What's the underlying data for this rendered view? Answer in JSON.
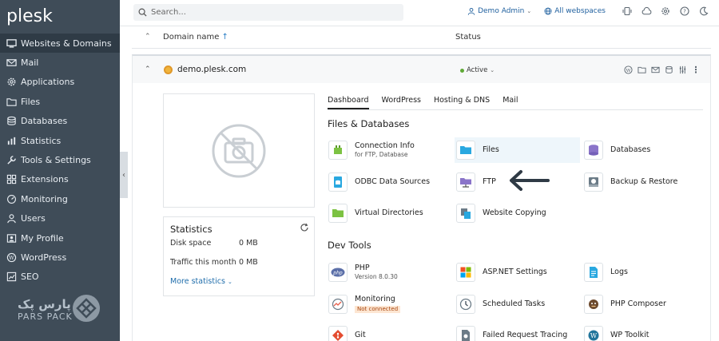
{
  "app": {
    "logo": "plesk"
  },
  "sidebar": {
    "items": [
      {
        "label": "Websites & Domains",
        "icon": "monitor-icon",
        "active": true
      },
      {
        "label": "Mail",
        "icon": "mail-icon"
      },
      {
        "label": "Applications",
        "icon": "gear-icon"
      },
      {
        "label": "Files",
        "icon": "folder-icon"
      },
      {
        "label": "Databases",
        "icon": "database-icon"
      },
      {
        "label": "Statistics",
        "icon": "stats-icon"
      },
      {
        "label": "Tools & Settings",
        "icon": "tools-icon"
      },
      {
        "label": "Extensions",
        "icon": "extensions-icon"
      },
      {
        "label": "Monitoring",
        "icon": "monitoring-icon"
      },
      {
        "label": "Users",
        "icon": "user-icon"
      },
      {
        "label": "My Profile",
        "icon": "profile-icon"
      },
      {
        "label": "WordPress",
        "icon": "wordpress-icon"
      },
      {
        "label": "SEO",
        "icon": "seo-icon"
      }
    ],
    "watermark": {
      "text": "پارس پک",
      "subtext": "PARS PACK"
    }
  },
  "topbar": {
    "search_placeholder": "Search...",
    "user": "Demo Admin",
    "webspaces": "All webspaces"
  },
  "table": {
    "col_name": "Domain name",
    "sort_glyph": "↑",
    "col_status": "Status"
  },
  "domain": {
    "name": "demo.plesk.com",
    "status": "Active"
  },
  "stats": {
    "title": "Statistics",
    "disk_label": "Disk space",
    "disk_value": "0 MB",
    "traffic_label": "Traffic this month",
    "traffic_value": "0 MB",
    "more": "More statistics"
  },
  "tabs": [
    "Dashboard",
    "WordPress",
    "Hosting & DNS",
    "Mail"
  ],
  "sections": {
    "files_db": "Files & Databases",
    "dev_tools": "Dev Tools"
  },
  "tools": {
    "connection_info": {
      "label": "Connection Info",
      "sub": "for FTP, Database"
    },
    "files": {
      "label": "Files"
    },
    "databases": {
      "label": "Databases"
    },
    "odbc": {
      "label": "ODBC Data Sources"
    },
    "ftp": {
      "label": "FTP"
    },
    "backup": {
      "label": "Backup & Restore"
    },
    "virtual_dirs": {
      "label": "Virtual Directories"
    },
    "website_copying": {
      "label": "Website Copying"
    },
    "php": {
      "label": "PHP",
      "sub": "Version 8.0.30"
    },
    "aspnet": {
      "label": "ASP.NET Settings"
    },
    "logs": {
      "label": "Logs"
    },
    "monitoring": {
      "label": "Monitoring",
      "badge": "Not connected"
    },
    "scheduled": {
      "label": "Scheduled Tasks"
    },
    "composer": {
      "label": "PHP Composer"
    },
    "git": {
      "label": "Git"
    },
    "failed_req": {
      "label": "Failed Request Tracing"
    },
    "wp_toolkit": {
      "label": "WP Toolkit"
    }
  },
  "colors": {
    "sidebar_bg": "#3f4c58",
    "sidebar_active": "#2f3b46",
    "link": "#1f6dab",
    "active_status": "#5fa936"
  }
}
